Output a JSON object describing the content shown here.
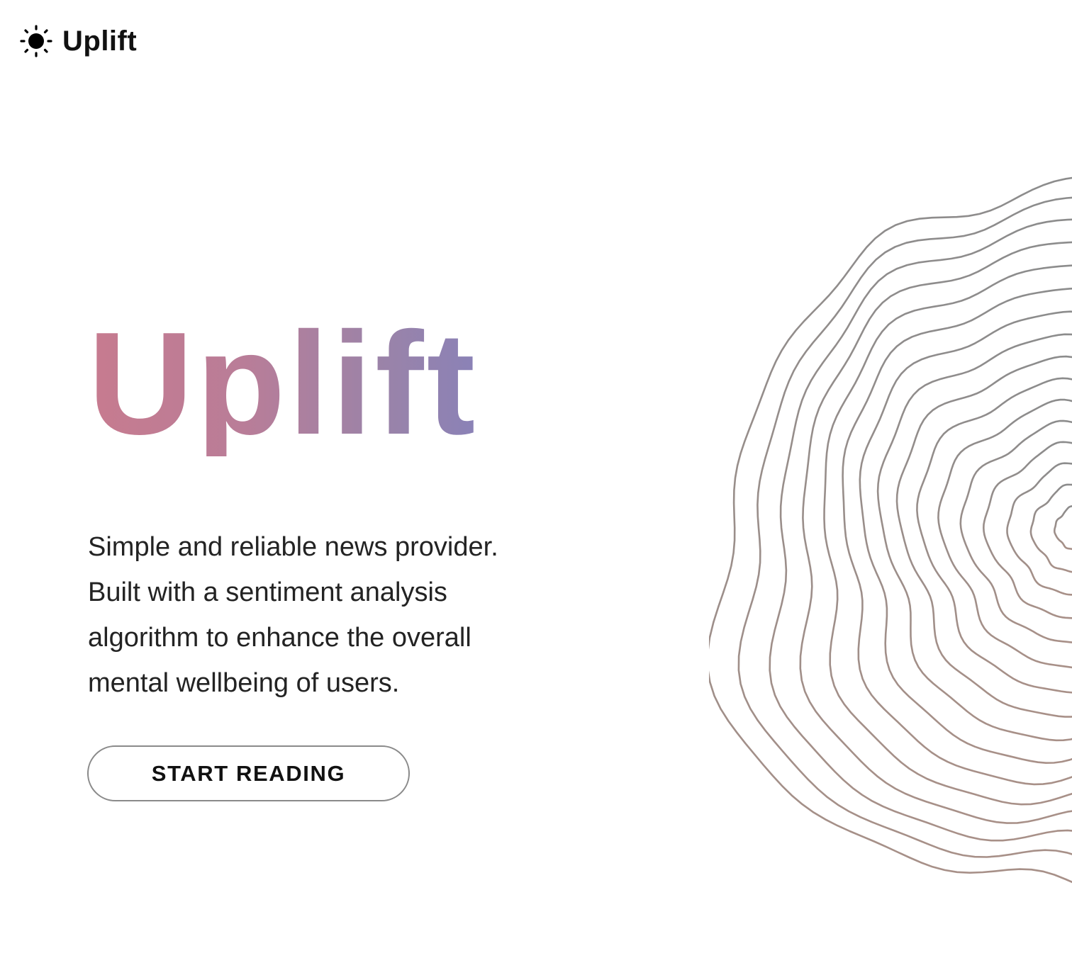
{
  "brand": {
    "icon": "sun-icon",
    "name": "Uplift"
  },
  "hero": {
    "title": "Uplift",
    "tagline_lines": [
      "Simple and reliable news provider.",
      "Built with a sentiment analysis",
      "algorithm to enhance the overall",
      "mental wellbeing of users."
    ],
    "cta_label": "START READING"
  },
  "decoration": {
    "name": "topographic-contour-art"
  },
  "colors": {
    "title_gradient_start": "#c77b8f",
    "title_gradient_end": "#8a82b7",
    "contour_top": "#8c8c8c",
    "contour_bottom": "#a89088",
    "button_border": "#8a8a8a"
  }
}
